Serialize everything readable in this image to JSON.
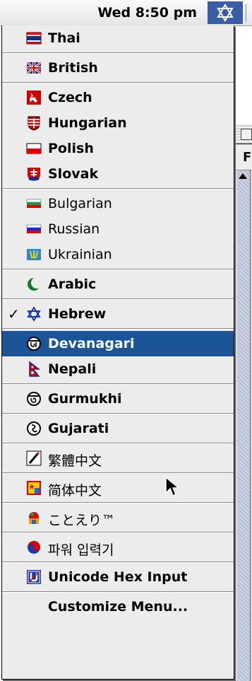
{
  "menubar": {
    "clock": "Wed 8:50 pm",
    "keyboard_icon": "hebrew-star-icon"
  },
  "background_window": {
    "visible_letter": "F"
  },
  "menu": {
    "groups": [
      [
        {
          "label": "Thai",
          "icon": "flag-thai-icon",
          "bold": true
        }
      ],
      [
        {
          "label": "British",
          "icon": "flag-british-icon",
          "bold": true
        }
      ],
      [
        {
          "label": "Czech",
          "icon": "flag-czech-icon",
          "bold": true
        },
        {
          "label": "Hungarian",
          "icon": "flag-hungarian-icon",
          "bold": true
        },
        {
          "label": "Polish",
          "icon": "flag-polish-icon",
          "bold": true
        },
        {
          "label": "Slovak",
          "icon": "flag-slovak-icon",
          "bold": true
        }
      ],
      [
        {
          "label": "Bulgarian",
          "icon": "flag-bulgarian-icon",
          "bold": false
        },
        {
          "label": "Russian",
          "icon": "flag-russian-icon",
          "bold": false
        },
        {
          "label": "Ukrainian",
          "icon": "flag-ukrainian-icon",
          "bold": false
        }
      ],
      [
        {
          "label": "Arabic",
          "icon": "crescent-icon",
          "bold": true
        }
      ],
      [
        {
          "label": "Hebrew",
          "icon": "star-of-david-icon",
          "bold": true,
          "checked": true,
          "check_mark": "✓"
        }
      ],
      [
        {
          "label": "Devanagari",
          "icon": "devanagari-script-icon",
          "bold": true,
          "selected": true
        },
        {
          "label": "Nepali",
          "icon": "flag-nepal-icon",
          "bold": true
        }
      ],
      [
        {
          "label": "Gurmukhi",
          "icon": "gurmukhi-script-icon",
          "bold": true
        }
      ],
      [
        {
          "label": "Gujarati",
          "icon": "gujarati-script-icon",
          "bold": true
        }
      ],
      [
        {
          "label": "繁體中文",
          "icon": "traditional-chinese-icon",
          "bold": false
        }
      ],
      [
        {
          "label": "简体中文",
          "icon": "simplified-chinese-icon",
          "bold": false
        }
      ],
      [
        {
          "label": "ことえり™",
          "icon": "kotoeri-icon",
          "bold": false
        }
      ],
      [
        {
          "label": "파워 입력기",
          "icon": "korean-taeguk-icon",
          "bold": false
        }
      ],
      [
        {
          "label": "Unicode Hex Input",
          "icon": "unicode-hex-icon",
          "bold": true
        }
      ],
      [
        {
          "label": "Customize Menu...",
          "icon": "",
          "bold": true,
          "center": true
        }
      ]
    ]
  },
  "colors": {
    "menu_bg": "#ececec",
    "selection": "#1b5597",
    "menubar_icon_bg": "#3a5ea5"
  }
}
